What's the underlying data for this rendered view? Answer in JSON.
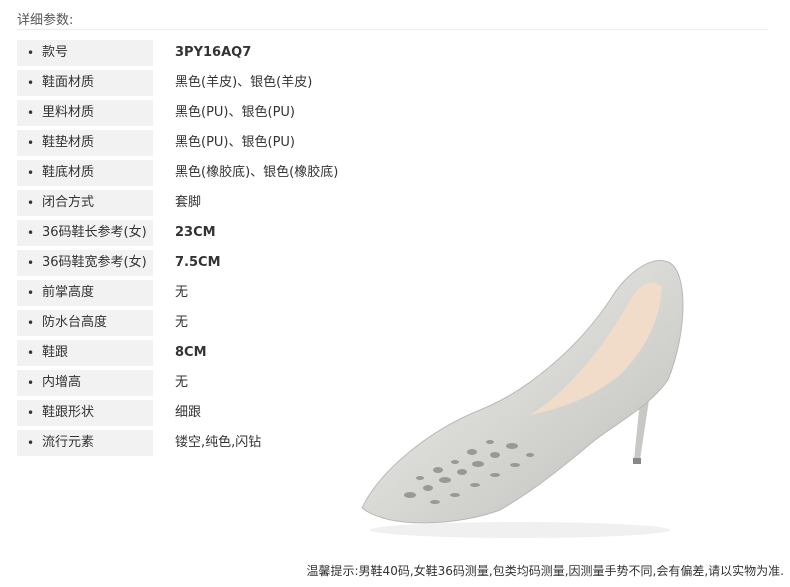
{
  "header": {
    "title": "详细参数:"
  },
  "specs": [
    {
      "label": "款号",
      "value": "3PY16AQ7"
    },
    {
      "label": "鞋面材质",
      "value": "黑色(羊皮)、银色(羊皮)"
    },
    {
      "label": "里料材质",
      "value": "黑色(PU)、银色(PU)"
    },
    {
      "label": "鞋垫材质",
      "value": "黑色(PU)、银色(PU)"
    },
    {
      "label": "鞋底材质",
      "value": "黑色(橡胶底)、银色(橡胶底)"
    },
    {
      "label": "闭合方式",
      "value": "套脚"
    },
    {
      "label": "36码鞋长参考(女)",
      "value": "23CM"
    },
    {
      "label": "36码鞋宽参考(女)",
      "value": "7.5CM"
    },
    {
      "label": "前掌高度",
      "value": "无"
    },
    {
      "label": "防水台高度",
      "value": "无"
    },
    {
      "label": "鞋跟",
      "value": "8CM"
    },
    {
      "label": "内增高",
      "value": "无"
    },
    {
      "label": "鞋跟形状",
      "value": "细跟"
    },
    {
      "label": "流行元素",
      "value": "镂空,纯色,闪钻"
    }
  ],
  "bullet": "•",
  "footer": {
    "tip": "温馨提示:男鞋40码,女鞋36码测量,包类均码测量,因测量手势不同,会有偏差,请以实物为准."
  },
  "colors": {
    "label_bg": "#f2f2f2",
    "shoe_silver": "#dcdcda",
    "lining": "#f0dcc8"
  }
}
